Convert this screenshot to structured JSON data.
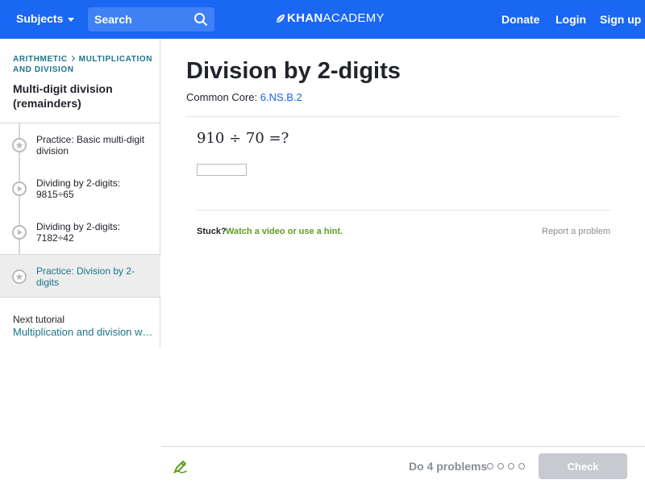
{
  "topbar": {
    "subjects_label": "Subjects",
    "search_placeholder": "Search",
    "logo_khan": "KHAN",
    "logo_academy": "ACADEMY",
    "donate_label": "Donate",
    "login_label": "Login",
    "signup_label": "Sign up",
    "brand_color": "#1967f2"
  },
  "sidebar": {
    "breadcrumb": [
      "ARITHMETIC",
      "MULTIPLICATION AND DIVISION"
    ],
    "tutorial_title": "Multi-digit division (remainders)",
    "items": [
      {
        "label": "Practice: Basic multi-digit division",
        "icon": "star-icon",
        "active": false
      },
      {
        "label": "Dividing by 2-digits: 9815÷65",
        "icon": "play-icon",
        "active": false
      },
      {
        "label": "Dividing by 2-digits: 7182÷42",
        "icon": "play-icon",
        "active": false
      },
      {
        "label": "Practice: Division by 2-digits",
        "icon": "star-icon",
        "active": true
      }
    ],
    "next_caption": "Next tutorial",
    "next_title": "Multiplication and division word problems"
  },
  "main": {
    "title": "Division by 2-digits",
    "common_core_label": "Common Core:",
    "common_core_code": "6.NS.B.2",
    "problem": "910 ÷ 70 =?",
    "answer_value": "",
    "stuck_label": "Stuck?",
    "hint_label": "Watch a video or use a hint.",
    "report_label": "Report a problem"
  },
  "bottombar": {
    "do_label": "Do 4 problems",
    "progress_completed": 0,
    "progress_total": 4,
    "check_label": "Check"
  }
}
